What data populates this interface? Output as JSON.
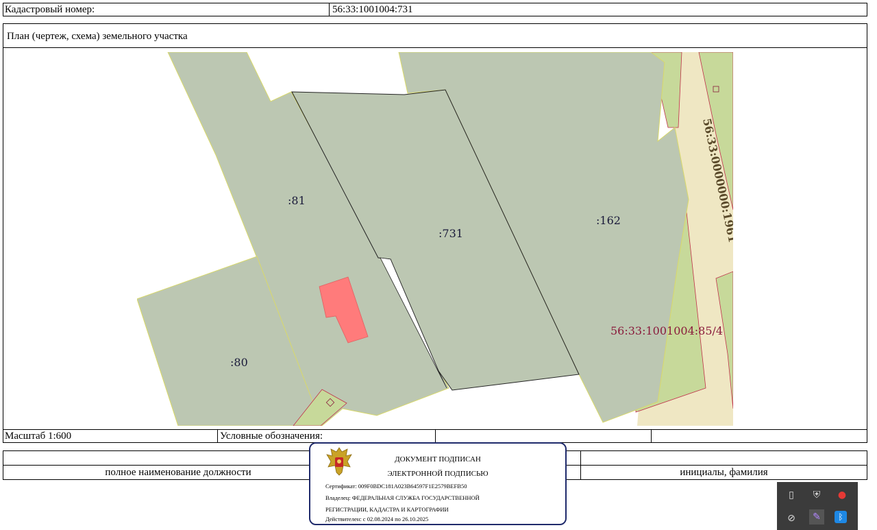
{
  "header": {
    "cadastral_label": "Кадастровый номер:",
    "cadastral_value": "56:33:1001004:731"
  },
  "plan": {
    "title": "План (чертеж, схема) земельного участка",
    "parcels": [
      {
        "label": ":81"
      },
      {
        "label": ":731"
      },
      {
        "label": ":162"
      },
      {
        "label": ":80"
      }
    ],
    "road_label": "56:33:0000000:1961",
    "quarter_label": "56:33:1001004:85/4",
    "colors": {
      "parcel_fill": "#bcc7b2",
      "road_fill": "#efe7c3",
      "green_fill": "#c7d99a",
      "building_fill": "#ff7b7b",
      "boundary_line": "#d9d96a",
      "border_red": "#c0304a",
      "label_dark": "#1a1a3a",
      "label_red": "#8a1c3c"
    }
  },
  "scale": {
    "scale_label": "Масштаб 1:600",
    "legend_label": "Условные обозначения:"
  },
  "signatures": {
    "position_caption": "полное наименование должности",
    "name_caption": "инициалы, фамилия"
  },
  "stamp": {
    "line1": "ДОКУМЕНТ ПОДПИСАН",
    "line2": "ЭЛЕКТРОННОЙ ПОДПИСЬЮ",
    "certificate": "Сертификат: 009F0BDC181A023B64597F1E2579BEFB50",
    "owner_line1": "Владелец: ФЕДЕРАЛЬНАЯ СЛУЖБА ГОСУДАРСТВЕННОЙ",
    "owner_line2": "РЕГИСТРАЦИИ, КАДАСТРА И КАРТОГРАФИИ",
    "validity": "Действителен: с 02.08.2024 по 26.10.2025",
    "border_color": "#1f2a6b"
  },
  "tray": {
    "icons": [
      "usb-drive-icon",
      "shield-icon",
      "opera-icon",
      "drive-offline-icon",
      "pen-icon",
      "bluetooth-icon"
    ]
  }
}
